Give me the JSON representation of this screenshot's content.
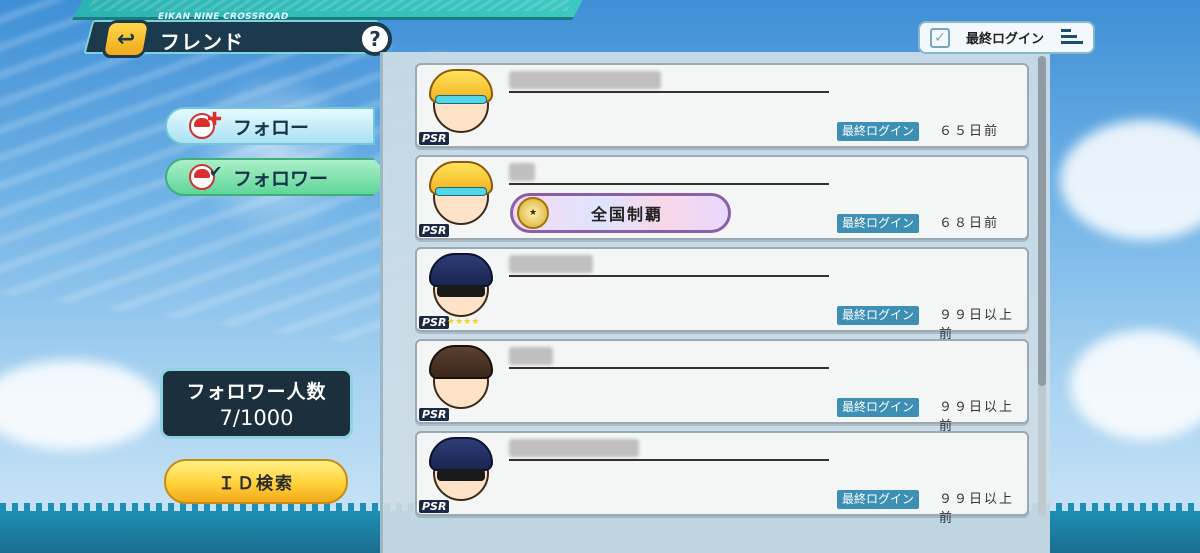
{
  "header": {
    "subtitle": "EIKAN NINE CROSSROAD",
    "title": "フレンド",
    "back_icon": "back-arrow-icon",
    "help_label": "?"
  },
  "tabs": [
    {
      "label": "フォロー",
      "active": false
    },
    {
      "label": "フォロワー",
      "active": true
    }
  ],
  "follower_count": {
    "label": "フォロワー人数",
    "value": "7/1000"
  },
  "id_search": {
    "label": "ＩＤ検索"
  },
  "sort": {
    "label": "最終ログイン"
  },
  "rows": [
    {
      "avatar_rank": "PSR",
      "login_label": "最終ログイン",
      "login_value": "６５日前",
      "title": ""
    },
    {
      "avatar_rank": "PSR",
      "login_label": "最終ログイン",
      "login_value": "６８日前",
      "title": "全国制覇"
    },
    {
      "avatar_rank": "PSR",
      "login_label": "最終ログイン",
      "login_value": "９９日以上前",
      "title": ""
    },
    {
      "avatar_rank": "PSR",
      "login_label": "最終ログイン",
      "login_value": "９９日以上前",
      "title": ""
    },
    {
      "avatar_rank": "PSR",
      "login_label": "最終ログイン",
      "login_value": "９９日以上前",
      "title": ""
    }
  ],
  "colors": {
    "accent_teal": "#2bb3b3",
    "header_dark": "#1b3a4d",
    "login_tag": "#3d8fb3",
    "id_button": "#ffd23a",
    "follower_tab": "#5fd69a"
  }
}
